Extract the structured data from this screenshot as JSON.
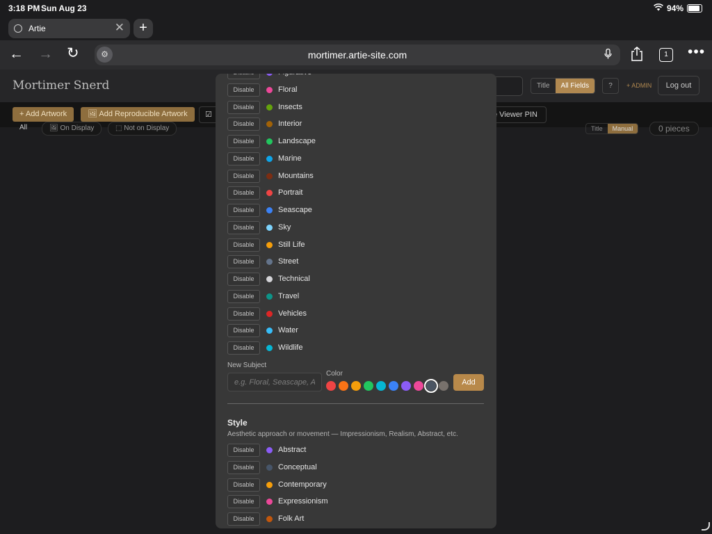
{
  "status_bar": {
    "time": "3:18 PM",
    "date": "Sun Aug 23",
    "battery": "94%"
  },
  "browser": {
    "tab_title": "Artie",
    "url": "mortimer.artie-site.com",
    "tab_count": "1"
  },
  "page": {
    "brand": "Mortimer Snerd",
    "search_mode": {
      "options": [
        "Title",
        "All Fields"
      ],
      "selected": "All Fields"
    },
    "help_label": "?",
    "admin_label": "+ ADMIN",
    "logout_label": "Log out",
    "actions": {
      "add_artwork": "+ Add Artwork",
      "add_reproducible": "🖼 Add Reproducible Artwork",
      "viewer_pin": "e Viewer PIN",
      "check_icon_label": "☑"
    },
    "filters": {
      "all": "All",
      "on_display": "🖼 On Display",
      "not_on_display": "⬚ Not on Display",
      "sort_options": [
        "Title",
        "Manual"
      ],
      "sort_selected": "Manual",
      "count": "0 pieces"
    }
  },
  "modal": {
    "subjects": [
      {
        "name": "Figurative",
        "color": "#8b5cf6",
        "action": "Disable"
      },
      {
        "name": "Floral",
        "color": "#ec4899",
        "action": "Disable"
      },
      {
        "name": "Insects",
        "color": "#65a30d",
        "action": "Disable"
      },
      {
        "name": "Interior",
        "color": "#a16207",
        "action": "Disable"
      },
      {
        "name": "Landscape",
        "color": "#22c55e",
        "action": "Disable"
      },
      {
        "name": "Marine",
        "color": "#0ea5e9",
        "action": "Disable"
      },
      {
        "name": "Mountains",
        "color": "#7c2d12",
        "action": "Disable"
      },
      {
        "name": "Portrait",
        "color": "#ef4444",
        "action": "Disable"
      },
      {
        "name": "Seascape",
        "color": "#3b82f6",
        "action": "Disable"
      },
      {
        "name": "Sky",
        "color": "#7dd3fc",
        "action": "Disable"
      },
      {
        "name": "Still Life",
        "color": "#f59e0b",
        "action": "Disable"
      },
      {
        "name": "Street",
        "color": "#64748b",
        "action": "Disable"
      },
      {
        "name": "Technical",
        "color": "#d4d4d8",
        "action": "Disable"
      },
      {
        "name": "Travel",
        "color": "#0d9488",
        "action": "Disable"
      },
      {
        "name": "Vehicles",
        "color": "#dc2626",
        "action": "Disable"
      },
      {
        "name": "Water",
        "color": "#38bdf8",
        "action": "Disable"
      },
      {
        "name": "Wildlife",
        "color": "#06b6d4",
        "action": "Disable"
      }
    ],
    "new_subject": {
      "label": "New Subject",
      "placeholder": "e.g. Floral, Seascape, Abstract",
      "color_label": "Color",
      "swatches": [
        "#ef4444",
        "#f97316",
        "#f59e0b",
        "#22c55e",
        "#06b6d4",
        "#3b82f6",
        "#8b5cf6",
        "#ec4899",
        "#4b5563",
        "#78716c"
      ],
      "selected_swatch": 8,
      "add_label": "Add"
    },
    "style_section": {
      "title": "Style",
      "description": "Aesthetic approach or movement — Impressionism, Realism, Abstract, etc.",
      "items": [
        {
          "name": "Abstract",
          "color": "#8b5cf6",
          "action": "Disable"
        },
        {
          "name": "Conceptual",
          "color": "#475569",
          "action": "Disable"
        },
        {
          "name": "Contemporary",
          "color": "#f59e0b",
          "action": "Disable"
        },
        {
          "name": "Expressionism",
          "color": "#ec4899",
          "action": "Disable"
        },
        {
          "name": "Folk Art",
          "color": "#c2570c",
          "action": "Disable"
        }
      ]
    }
  }
}
